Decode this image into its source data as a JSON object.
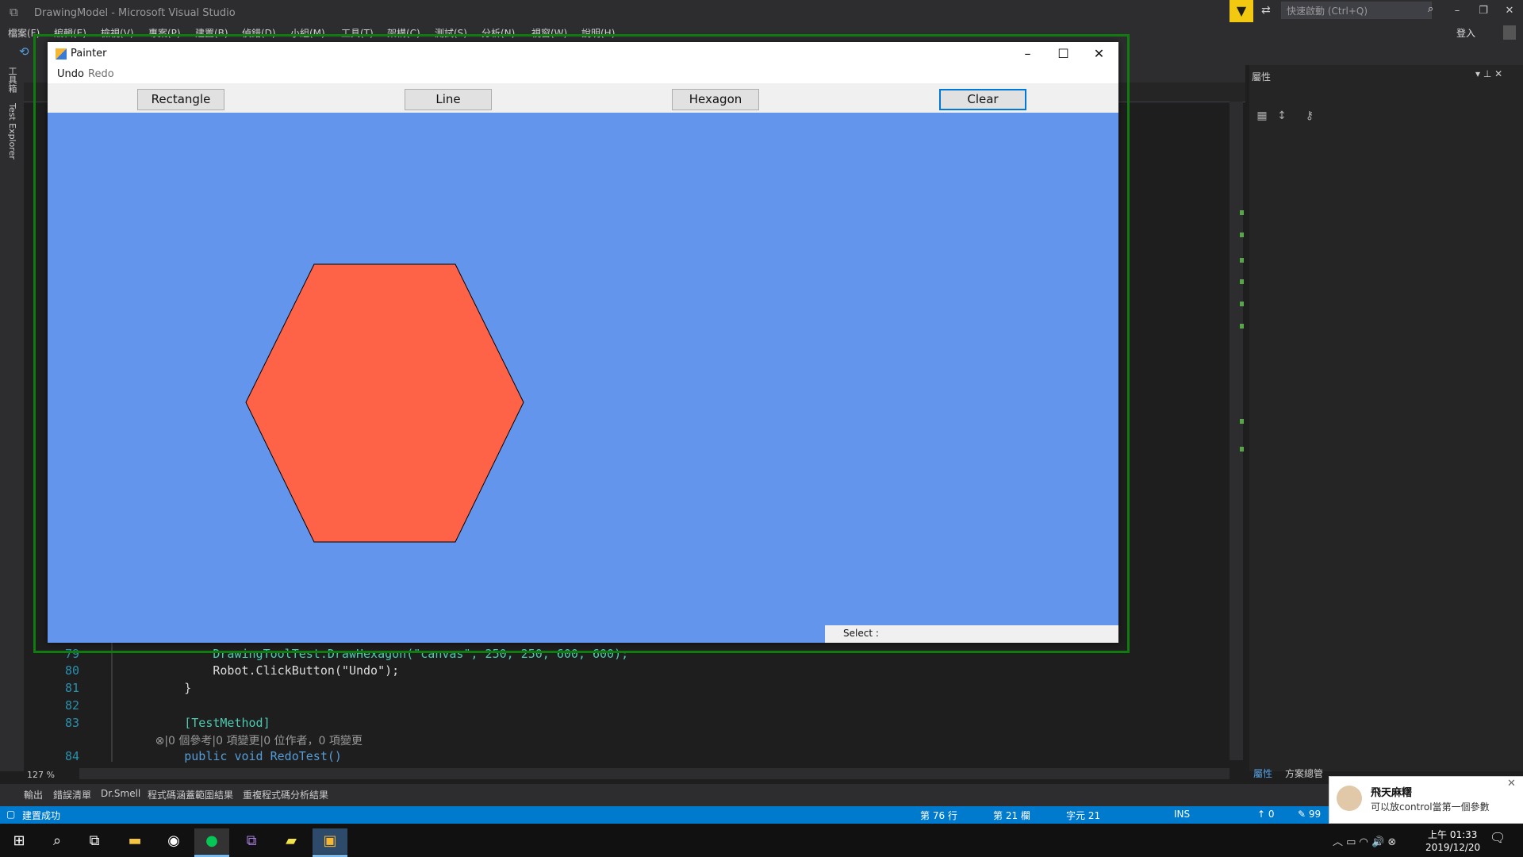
{
  "vs": {
    "title": "DrawingModel - Microsoft Visual Studio",
    "quick_launch_placeholder": "快速啟動 (Ctrl+Q)",
    "sign_in": "登入",
    "menu": [
      "檔案(F)",
      "編輯(E)",
      "檢視(V)",
      "專案(P)",
      "建置(B)",
      "偵錯(D)",
      "小組(M)",
      "工具(T)",
      "架構(C)",
      "測試(S)",
      "分析(N)",
      "視窗(W)",
      "說明(H)"
    ],
    "left_tabs": {
      "toolbox": "工具箱",
      "test_explorer": "Test Explorer"
    },
    "editor": {
      "lines": [
        {
          "num": "79",
          "code": "            DrawingToolTest.DrawHexagon(\"canvas\", 250, 250, 600, 600);"
        },
        {
          "num": "80",
          "code": "            Robot.ClickButton(\"Undo\");"
        },
        {
          "num": "81",
          "code": "        }"
        },
        {
          "num": "82",
          "code": ""
        },
        {
          "num": "83",
          "code": "        [TestMethod]"
        },
        {
          "num": "",
          "code": "        ⊗|0 個參考|0 項變更|0 位作者，0 項變更"
        },
        {
          "num": "84",
          "code": "        public void RedoTest()"
        }
      ],
      "zoom": "127 %"
    },
    "properties": {
      "title": "屬性",
      "tab_properties": "屬性",
      "tab_solution": "方案總管"
    },
    "bottom_tabs": [
      "輸出",
      "錯誤清單",
      "Dr.Smell",
      "程式碼涵蓋範圍結果",
      "重複程式碼分析結果"
    ],
    "status": {
      "message": "建置成功",
      "line": "第 76 行",
      "col": "第 21 欄",
      "char": "字元 21",
      "mode": "INS",
      "up": "↑ 0",
      "edit": "✎ 99"
    }
  },
  "painter": {
    "title": "Painter",
    "menu": {
      "undo": "Undo",
      "redo": "Redo"
    },
    "buttons": {
      "rectangle": "Rectangle",
      "line": "Line",
      "hexagon": "Hexagon",
      "clear": "Clear"
    },
    "canvas_color": "#6495ed",
    "hexagon_color": "#ff6347",
    "select_label": "Select :"
  },
  "notification": {
    "title": "飛天麻糬",
    "text": "可以放control當第一個參數"
  },
  "taskbar": {
    "time": "上午 01:33",
    "date": "2019/12/20"
  },
  "colors": {
    "accent": "#007acc",
    "highlight": "#107c10"
  }
}
